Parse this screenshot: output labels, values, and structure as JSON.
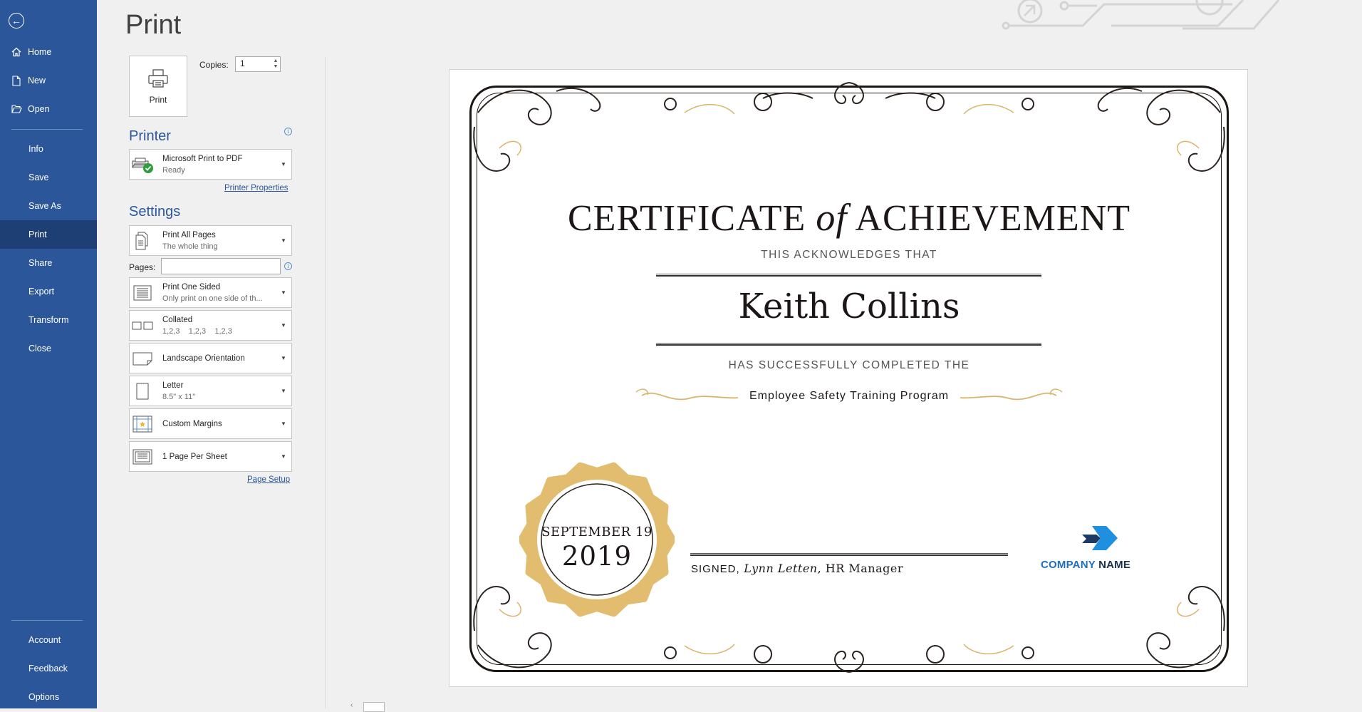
{
  "sidebar": {
    "items": [
      {
        "label": "Home"
      },
      {
        "label": "New"
      },
      {
        "label": "Open"
      },
      {
        "label": "Info"
      },
      {
        "label": "Save"
      },
      {
        "label": "Save As"
      },
      {
        "label": "Print"
      },
      {
        "label": "Share"
      },
      {
        "label": "Export"
      },
      {
        "label": "Transform"
      },
      {
        "label": "Close"
      },
      {
        "label": "Account"
      },
      {
        "label": "Feedback"
      },
      {
        "label": "Options"
      }
    ],
    "active": "Print",
    "bg_color": "#2b579a"
  },
  "page": {
    "title": "Print"
  },
  "print": {
    "button_label": "Print",
    "copies_label": "Copies:",
    "copies_value": "1"
  },
  "printer": {
    "heading": "Printer",
    "name": "Microsoft Print to PDF",
    "status": "Ready",
    "properties_link": "Printer Properties"
  },
  "settings": {
    "heading": "Settings",
    "pages_label": "Pages:",
    "pages_value": "",
    "page_setup_link": "Page Setup",
    "options": [
      {
        "main": "Print All Pages",
        "sub": "The whole thing",
        "icon": "pages-icon"
      },
      {
        "main": "Print One Sided",
        "sub": "Only print on one side of th...",
        "icon": "one-sided-icon"
      },
      {
        "main": "Collated",
        "sub": "1,2,3    1,2,3    1,2,3",
        "icon": "collated-icon"
      },
      {
        "main": "Landscape Orientation",
        "sub": "",
        "icon": "landscape-icon"
      },
      {
        "main": "Letter",
        "sub": "8.5\" x 11\"",
        "icon": "paper-size-icon"
      },
      {
        "main": "Custom Margins",
        "sub": "",
        "icon": "margins-icon"
      },
      {
        "main": "1 Page Per Sheet",
        "sub": "",
        "icon": "pages-per-sheet-icon"
      }
    ]
  },
  "certificate": {
    "title_part1": "CERTIFICATE",
    "title_of": "of",
    "title_part2": "ACHIEVEMENT",
    "acknowledges": "THIS ACKNOWLEDGES THAT",
    "recipient": "Keith Collins",
    "completed": "HAS SUCCESSFULLY COMPLETED THE",
    "program": "Employee Safety Training Program",
    "seal_month": "SEPTEMBER 19",
    "seal_year": "2019",
    "signed_prefix": "SIGNED,",
    "signer": "Lynn Letten",
    "signer_title": ", HR Manager",
    "company_word1": "COMPANY",
    "company_word2": "NAME"
  }
}
